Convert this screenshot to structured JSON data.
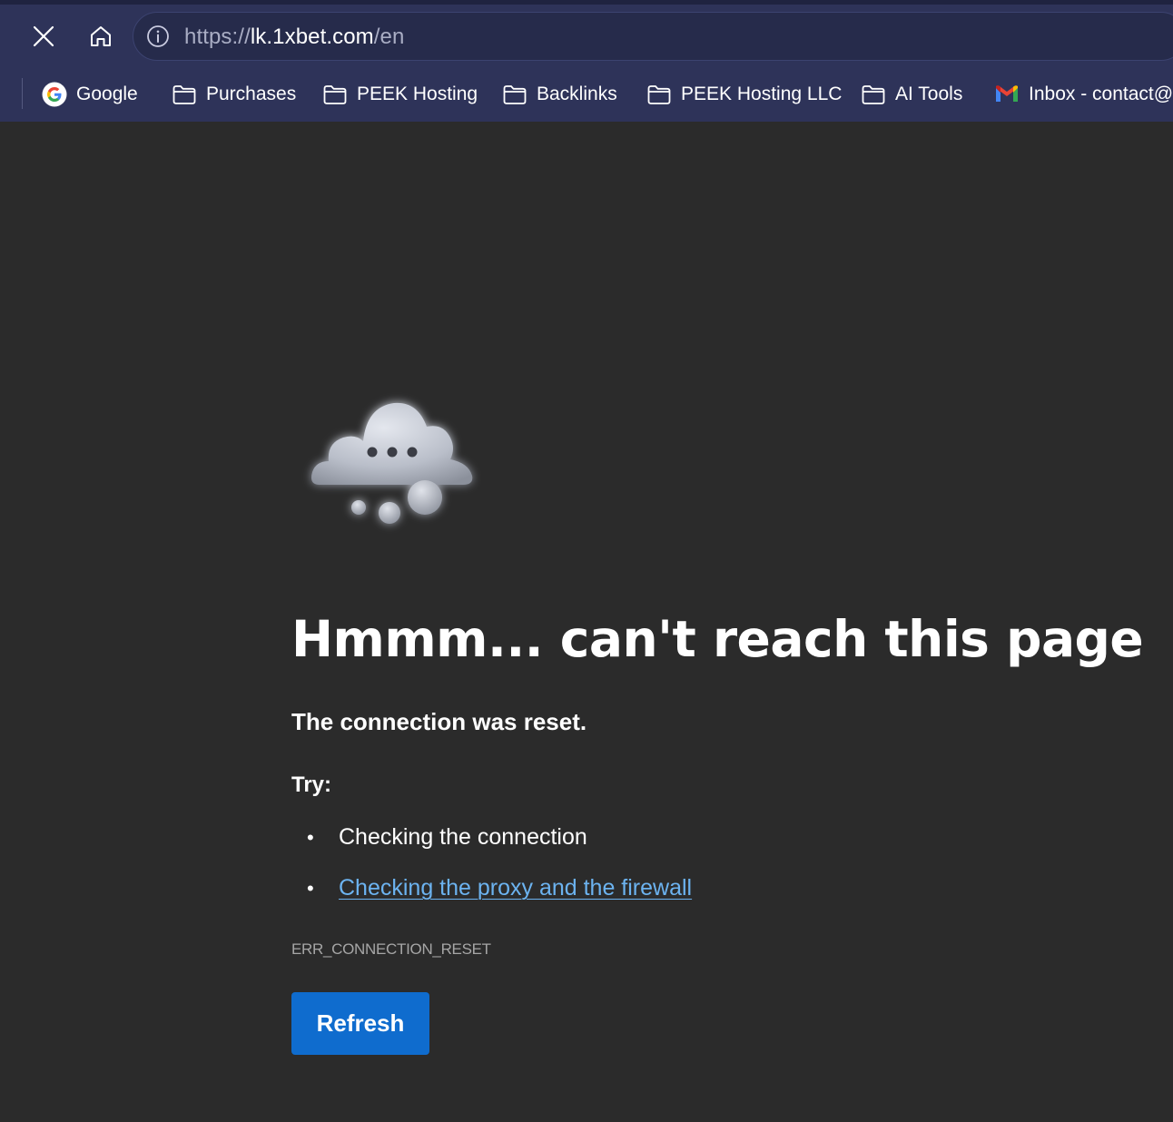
{
  "browser": {
    "url_scheme": "https://",
    "url_host": "lk.1xbet.com",
    "url_path": "/en",
    "nav_icons": [
      "close-icon",
      "home-icon",
      "info-icon"
    ]
  },
  "bookmarks": [
    {
      "label": "Google",
      "icon": "google-icon"
    },
    {
      "label": "Purchases",
      "icon": "folder-icon"
    },
    {
      "label": "PEEK Hosting",
      "icon": "folder-icon"
    },
    {
      "label": "Backlinks",
      "icon": "folder-icon"
    },
    {
      "label": "PEEK Hosting LLC",
      "icon": "folder-icon"
    },
    {
      "label": "AI Tools",
      "icon": "folder-icon"
    },
    {
      "label": "Inbox - contact@",
      "icon": "gmail-icon"
    }
  ],
  "error_page": {
    "title": "Hmmm... can't reach this page",
    "subtitle": "The connection was reset.",
    "try_label": "Try:",
    "suggestions": [
      {
        "text": "Checking the connection",
        "is_link": false
      },
      {
        "text": "Checking the proxy and the firewall",
        "is_link": true
      }
    ],
    "bullet": "•",
    "error_code": "ERR_CONNECTION_RESET",
    "refresh_label": "Refresh",
    "illustration": "thinking-cloud-icon"
  },
  "colors": {
    "chrome_bg": "#2e3359",
    "page_bg": "#2b2b2b",
    "link": "#6cb3f0",
    "button": "#0f6cce"
  }
}
